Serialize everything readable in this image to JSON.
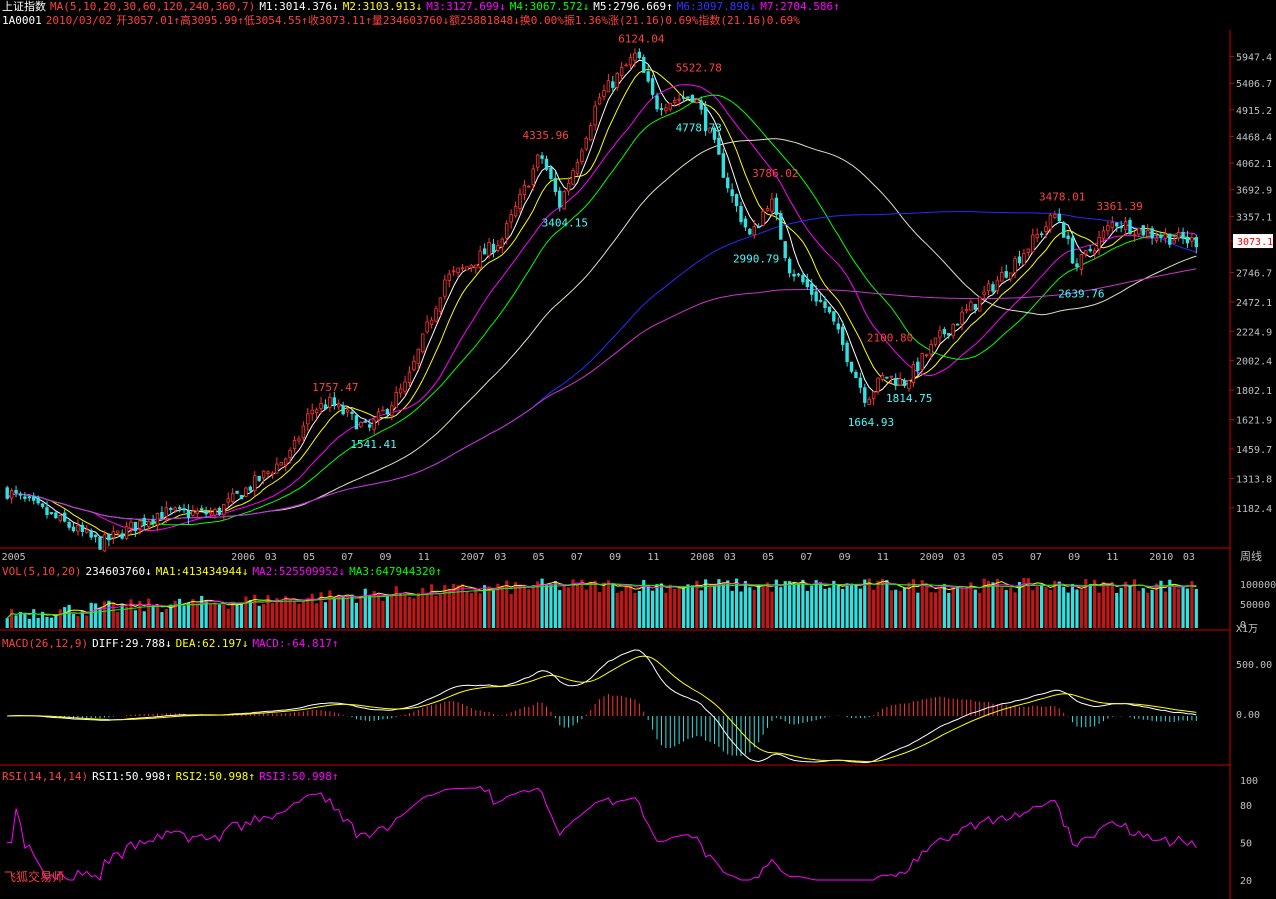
{
  "header": {
    "index_name": "上证指数",
    "ma_label": "MA(5,10,20,30,60,120,240,360,7)",
    "ma_values": [
      {
        "text": "M1:3014.376↓",
        "color": "#ffffff"
      },
      {
        "text": "M2:3103.913↓",
        "color": "#ffff00"
      },
      {
        "text": "M3:3127.699↓",
        "color": "#ff00ff"
      },
      {
        "text": "M4:3067.572↓",
        "color": "#00ff00"
      },
      {
        "text": "M5:2796.669↑",
        "color": "#ffffff"
      },
      {
        "text": "M6:3097.898↓",
        "color": "#3333ff"
      },
      {
        "text": "M7:2704.586↑",
        "color": "#ff00ff"
      }
    ],
    "code": "1A0001",
    "date": "2010/03/02",
    "quote_line": "开3057.01↑高3095.99↑低3054.55↑收3073.11↑量234603760↓额25881848↓换0.00%振1.36%涨(21.16)0.69%指数(21.16)0.69%"
  },
  "price_axis": {
    "labels": [
      "5947.4",
      "5406.7",
      "4915.2",
      "4468.4",
      "4062.1",
      "3692.9",
      "3357.1",
      "3073.1",
      "2746.7",
      "2472.1",
      "2224.9",
      "2002.4",
      "1802.1",
      "1621.9",
      "1459.7",
      "1313.8",
      "1182.4"
    ],
    "current": "3073.1"
  },
  "time_axis": {
    "labels": [
      "2005",
      "2006",
      "03",
      "05",
      "07",
      "09",
      "11",
      "2007",
      "03",
      "05",
      "07",
      "09",
      "11",
      "2008",
      "03",
      "05",
      "07",
      "09",
      "11",
      "2009",
      "03",
      "05",
      "07",
      "09",
      "11",
      "2010",
      "03"
    ],
    "period": "周线"
  },
  "volume": {
    "header": [
      {
        "text": "VOL(5,10,20)",
        "color": "#ff4040"
      },
      {
        "text": "234603760↓",
        "color": "#ffffff"
      },
      {
        "text": "MA1:413434944↓",
        "color": "#ffff00"
      },
      {
        "text": "MA2:525509952↓",
        "color": "#ff00ff"
      },
      {
        "text": "MA3:647944320↑",
        "color": "#00ff00"
      }
    ],
    "axis": [
      "100000",
      "50000",
      "0"
    ],
    "unit": "X1万"
  },
  "macd": {
    "header": [
      {
        "text": "MACD(26,12,9)",
        "color": "#ff4040"
      },
      {
        "text": "DIFF:29.788↓",
        "color": "#ffffff"
      },
      {
        "text": "DEA:62.197↓",
        "color": "#ffff00"
      },
      {
        "text": "MACD:-64.817↑",
        "color": "#ff00ff"
      }
    ],
    "axis": [
      "500.00",
      "0.00"
    ]
  },
  "rsi": {
    "header": [
      {
        "text": "RSI(14,14,14)",
        "color": "#ff4040"
      },
      {
        "text": "RSI1:50.998↑",
        "color": "#ffffff"
      },
      {
        "text": "RSI2:50.998↑",
        "color": "#ffff00"
      },
      {
        "text": "RSI3:50.998↑",
        "color": "#ff00ff"
      }
    ],
    "axis": [
      "100",
      "80",
      "50",
      "20"
    ]
  },
  "brand": "飞狐交易师",
  "chart_data": {
    "type": "candlestick",
    "subject": "上证指数 weekly, 2005–2010/03",
    "price_log_scale": true,
    "ylim": [
      1100,
      6200
    ],
    "annotations": [
      {
        "label": "6124.04",
        "value": 6124.04,
        "kind": "high",
        "date": "2007-10"
      },
      {
        "label": "5522.78",
        "value": 5522.78,
        "kind": "high",
        "date": "2008-01"
      },
      {
        "label": "4778.73",
        "value": 4778.73,
        "kind": "low",
        "date": "2008-01"
      },
      {
        "label": "4335.96",
        "value": 4335.96,
        "kind": "high",
        "date": "2007-05"
      },
      {
        "label": "3404.15",
        "value": 3404.15,
        "kind": "low",
        "date": "2007-06"
      },
      {
        "label": "3786.02",
        "value": 3786.02,
        "kind": "high",
        "date": "2008-05"
      },
      {
        "label": "2990.79",
        "value": 2990.79,
        "kind": "low",
        "date": "2008-04"
      },
      {
        "label": "2100.80",
        "value": 2100.8,
        "kind": "high",
        "date": "2008-11"
      },
      {
        "label": "1814.75",
        "value": 1814.75,
        "kind": "low",
        "date": "2008-12"
      },
      {
        "label": "1664.93",
        "value": 1664.93,
        "kind": "low",
        "date": "2008-10"
      },
      {
        "label": "1757.47",
        "value": 1757.47,
        "kind": "high",
        "date": "2006-06"
      },
      {
        "label": "1541.41",
        "value": 1541.41,
        "kind": "low",
        "date": "2006-08"
      },
      {
        "label": "3478.01",
        "value": 3478.01,
        "kind": "high",
        "date": "2009-08"
      },
      {
        "label": "2639.76",
        "value": 2639.76,
        "kind": "low",
        "date": "2009-09"
      },
      {
        "label": "3361.39",
        "value": 3361.39,
        "kind": "high",
        "date": "2009-11"
      }
    ],
    "close_path": [
      [
        "2005-01",
        1260
      ],
      [
        "2005-06",
        1040
      ],
      [
        "2005-09",
        1160
      ],
      [
        "2005-12",
        1160
      ],
      [
        "2006-02",
        1290
      ],
      [
        "2006-04",
        1440
      ],
      [
        "2006-05",
        1680
      ],
      [
        "2006-06",
        1720
      ],
      [
        "2006-08",
        1560
      ],
      [
        "2006-10",
        1840
      ],
      [
        "2006-12",
        2680
      ],
      [
        "2007-01",
        2780
      ],
      [
        "2007-03",
        3100
      ],
      [
        "2007-05",
        4200
      ],
      [
        "2007-06",
        3500
      ],
      [
        "2007-07",
        4200
      ],
      [
        "2007-08",
        5100
      ],
      [
        "2007-10",
        6000
      ],
      [
        "2007-11",
        5000
      ],
      [
        "2008-01",
        5200
      ],
      [
        "2008-02",
        4400
      ],
      [
        "2008-03",
        3600
      ],
      [
        "2008-04",
        3100
      ],
      [
        "2008-05",
        3600
      ],
      [
        "2008-06",
        2800
      ],
      [
        "2008-08",
        2400
      ],
      [
        "2008-10",
        1750
      ],
      [
        "2008-11",
        1900
      ],
      [
        "2008-12",
        1850
      ],
      [
        "2009-02",
        2200
      ],
      [
        "2009-04",
        2500
      ],
      [
        "2009-06",
        2900
      ],
      [
        "2009-08",
        3400
      ],
      [
        "2009-09",
        2800
      ],
      [
        "2009-11",
        3300
      ],
      [
        "2010-01",
        3150
      ],
      [
        "2010-03",
        3073
      ]
    ],
    "series": [
      {
        "name": "M1",
        "last": 3014.376
      },
      {
        "name": "M2",
        "last": 3103.913
      },
      {
        "name": "M3",
        "last": 3127.699
      },
      {
        "name": "M4",
        "last": 3067.572
      },
      {
        "name": "M5",
        "last": 2796.669
      },
      {
        "name": "M6",
        "last": 3097.898
      },
      {
        "name": "M7",
        "last": 2704.586
      }
    ],
    "volume_last": 234603760,
    "macd_last": {
      "DIFF": 29.788,
      "DEA": 62.197,
      "MACD": -64.817
    },
    "rsi_last": {
      "RSI1": 50.998,
      "RSI2": 50.998,
      "RSI3": 50.998
    },
    "colors": {
      "up": "#ff3333",
      "down": "#33e0e0",
      "white": "#ffffff",
      "yellow": "#ffff00",
      "magenta": "#ff00ff",
      "green": "#00ff00",
      "blue": "#2a2aff",
      "pink": "#cc33cc",
      "axis": "#cc0000",
      "label": "#c0c0c0"
    }
  }
}
